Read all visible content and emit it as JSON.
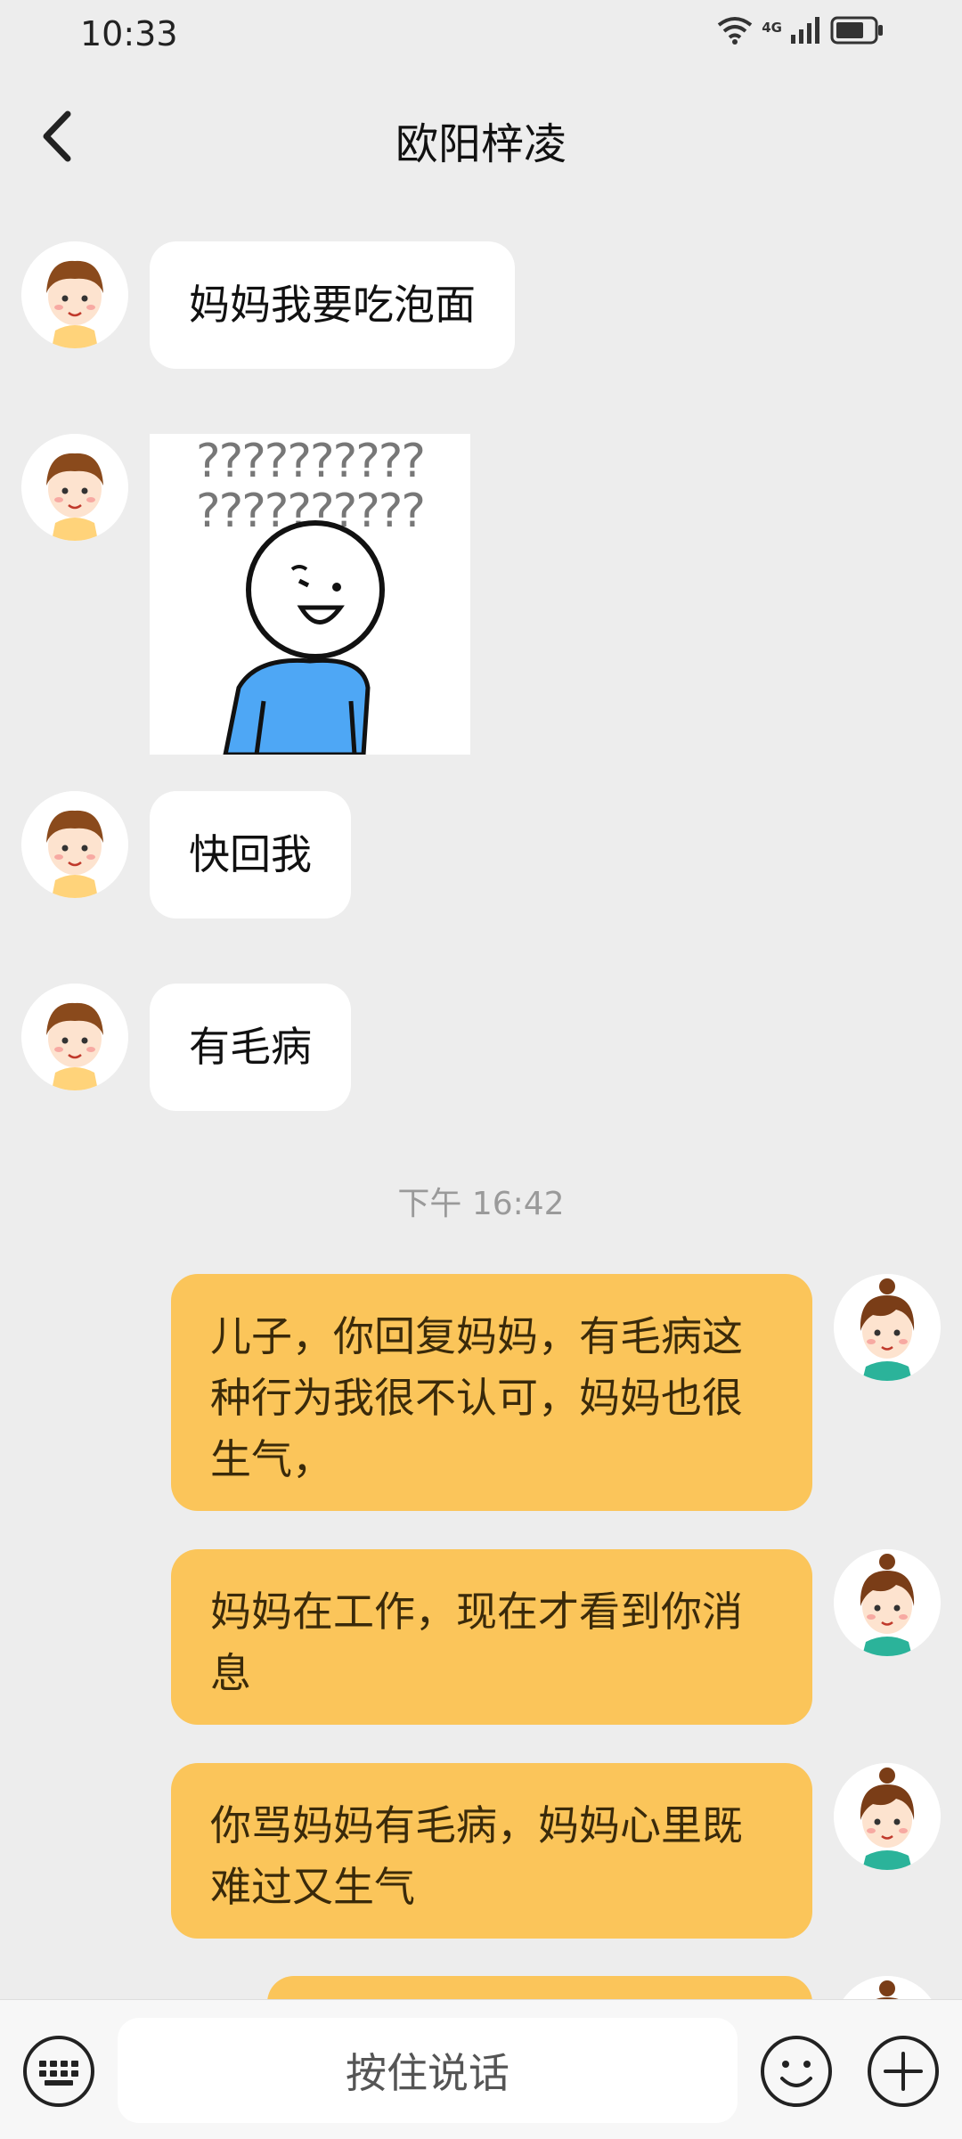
{
  "status_bar": {
    "time": "10:33",
    "network": "4G"
  },
  "header": {
    "title": "欧阳梓凌"
  },
  "messages": {
    "in1": "妈妈我要吃泡面",
    "sticker": {
      "text_row1": "??????????",
      "text_row2": "??????????"
    },
    "in3": "快回我",
    "in4": "有毛病",
    "timestamp": "下午 16:42",
    "out1": "儿子，你回复妈妈，有毛病这种行为我很不认可，妈妈也很生气，",
    "out2": "妈妈在工作，现在才看到你消息",
    "out3": "你骂妈妈有毛病，妈妈心里既难过又生气"
  },
  "input_bar": {
    "voice_label": "按住说话"
  },
  "colors": {
    "background": "#ededed",
    "incoming_bubble": "#ffffff",
    "outgoing_bubble": "#fbc55a",
    "sticker_shirt": "#4ea7f5"
  }
}
